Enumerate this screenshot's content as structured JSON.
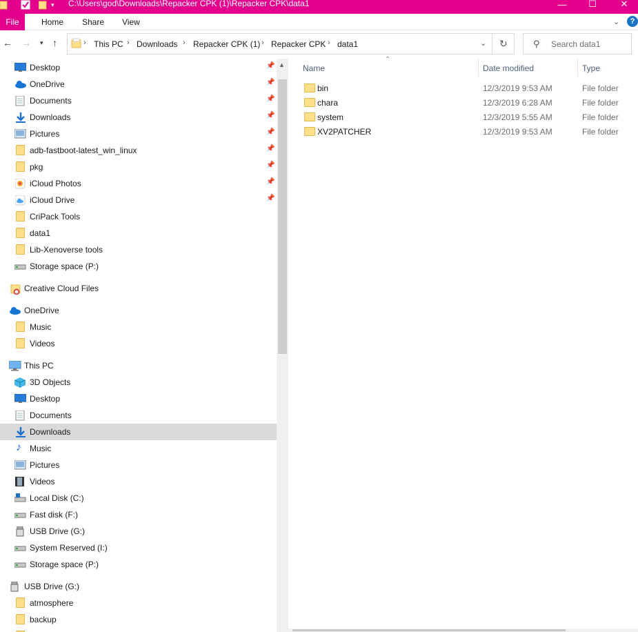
{
  "window": {
    "title": "C:\\Users\\god\\Downloads\\Repacker CPK (1)\\Repacker CPK\\data1",
    "accent": "#e2008c"
  },
  "ribbon": {
    "tabs": [
      "File",
      "Home",
      "Share",
      "View"
    ]
  },
  "address": {
    "crumbs": [
      "This PC",
      "Downloads",
      "Repacker CPK (1)",
      "Repacker CPK",
      "data1"
    ],
    "search_placeholder": "Search data1"
  },
  "nav": {
    "quick_access": [
      {
        "label": "Desktop",
        "icon": "desktop-icon",
        "pinned": true
      },
      {
        "label": "OneDrive",
        "icon": "onedrive-icon",
        "pinned": true
      },
      {
        "label": "Documents",
        "icon": "documents-icon",
        "pinned": true
      },
      {
        "label": "Downloads",
        "icon": "downloads-icon",
        "pinned": true
      },
      {
        "label": "Pictures",
        "icon": "pictures-icon",
        "pinned": true
      },
      {
        "label": "adb-fastboot-latest_win_linux",
        "icon": "folder-icon",
        "pinned": true
      },
      {
        "label": "pkg",
        "icon": "folder-icon",
        "pinned": true
      },
      {
        "label": "iCloud Photos",
        "icon": "icloud-photos-icon",
        "pinned": true
      },
      {
        "label": "iCloud Drive",
        "icon": "icloud-drive-icon",
        "pinned": true
      },
      {
        "label": "CriPack Tools",
        "icon": "folder-icon",
        "pinned": false
      },
      {
        "label": "data1",
        "icon": "folder-icon",
        "pinned": false
      },
      {
        "label": "Lib-Xenoverse tools",
        "icon": "folder-icon",
        "pinned": false
      },
      {
        "label": "Storage space (P:)",
        "icon": "drive-icon",
        "pinned": false
      }
    ],
    "creative_cloud": "Creative Cloud Files",
    "onedrive": {
      "label": "OneDrive",
      "children": [
        "Music",
        "Videos"
      ]
    },
    "this_pc": {
      "label": "This PC",
      "children": [
        {
          "label": "3D Objects",
          "icon": "3d-objects-icon"
        },
        {
          "label": "Desktop",
          "icon": "desktop-icon"
        },
        {
          "label": "Documents",
          "icon": "documents-icon"
        },
        {
          "label": "Downloads",
          "icon": "downloads-icon",
          "selected": true
        },
        {
          "label": "Music",
          "icon": "music-icon"
        },
        {
          "label": "Pictures",
          "icon": "pictures-icon"
        },
        {
          "label": "Videos",
          "icon": "videos-icon"
        },
        {
          "label": "Local Disk (C:)",
          "icon": "local-disk-icon"
        },
        {
          "label": "Fast disk (F:)",
          "icon": "drive-icon"
        },
        {
          "label": "USB Drive (G:)",
          "icon": "usb-drive-icon"
        },
        {
          "label": "System Reserved (I:)",
          "icon": "drive-icon"
        },
        {
          "label": "Storage space (P:)",
          "icon": "drive-icon"
        }
      ]
    },
    "usb_drive": {
      "label": "USB Drive (G:)",
      "children": [
        "atmosphere",
        "backup"
      ]
    }
  },
  "content": {
    "columns": [
      "Name",
      "Date modified",
      "Type"
    ],
    "files": [
      {
        "name": "bin",
        "date": "12/3/2019 9:53 AM",
        "type": "File folder"
      },
      {
        "name": "chara",
        "date": "12/3/2019 6:28 AM",
        "type": "File folder"
      },
      {
        "name": "system",
        "date": "12/3/2019 5:55 AM",
        "type": "File folder"
      },
      {
        "name": "XV2PATCHER",
        "date": "12/3/2019 9:53 AM",
        "type": "File folder"
      }
    ]
  }
}
